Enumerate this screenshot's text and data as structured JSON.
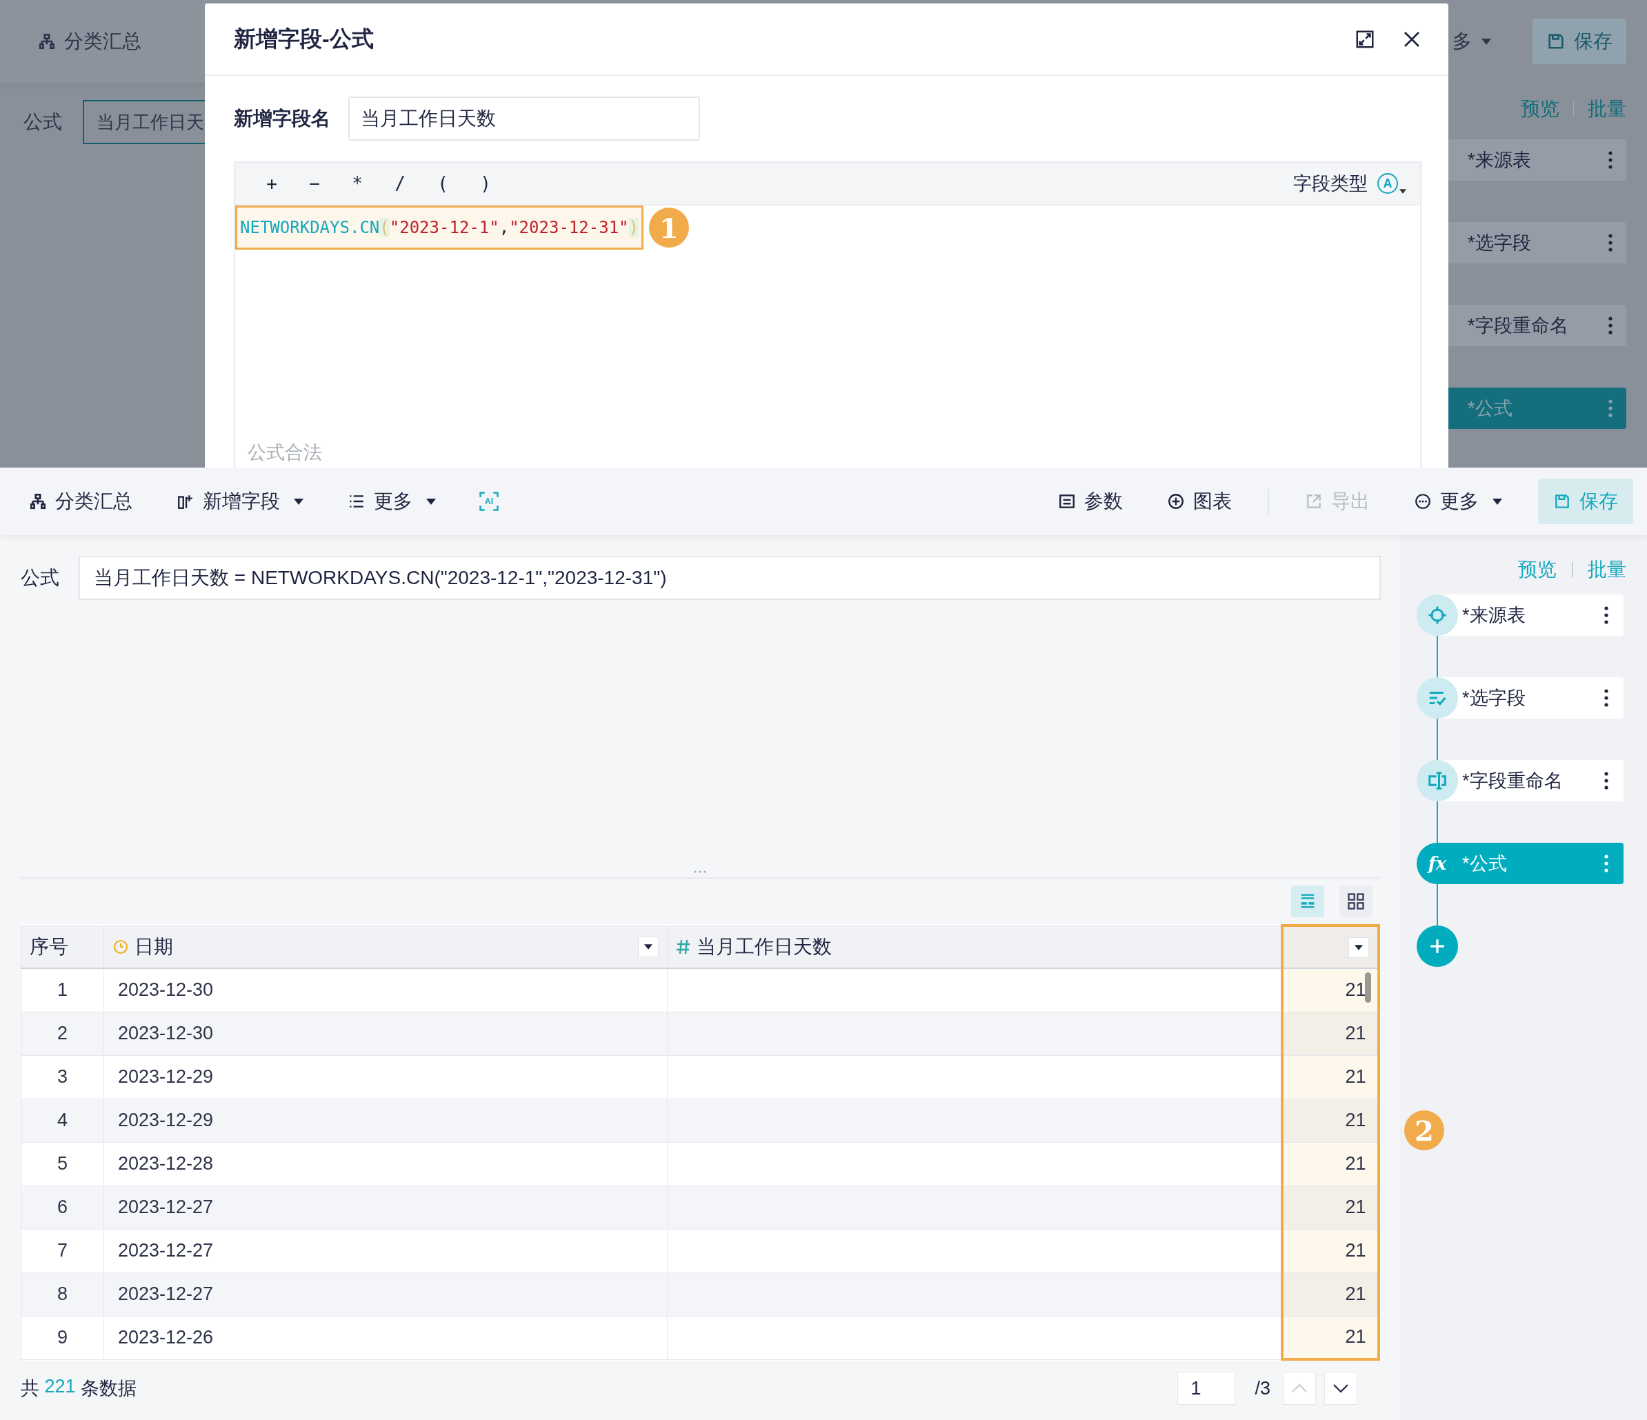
{
  "background": {
    "toolbar_label": "分类汇总",
    "formula_label": "公式",
    "formula_value": "当月工作日天",
    "more_label": "多",
    "save_label": "保存",
    "links": [
      "预览",
      "批量"
    ],
    "steps": [
      {
        "label": "*来源表",
        "selected": false
      },
      {
        "label": "*选字段",
        "selected": false
      },
      {
        "label": "*字段重命名",
        "selected": false
      },
      {
        "label": "*公式",
        "selected": true
      }
    ]
  },
  "dialog": {
    "title": "新增字段-公式",
    "name_label": "新增字段名",
    "name_value": "当月工作日天数",
    "operators": [
      "+",
      "−",
      "*",
      "/",
      "(",
      ")"
    ],
    "type_label": "字段类型",
    "type_badge": "A",
    "formula": [
      {
        "kind": "function",
        "text": "NETWORKDAYS.CN"
      },
      {
        "kind": "paren",
        "text": "("
      },
      {
        "kind": "string",
        "text": "\"2023-12-1\""
      },
      {
        "kind": "punct",
        "text": ","
      },
      {
        "kind": "string",
        "text": "\"2023-12-31\""
      },
      {
        "kind": "paren",
        "text": ")"
      }
    ],
    "callout": "1",
    "status": "公式合法"
  },
  "toolbar": {
    "left": [
      {
        "kind": "button",
        "label": "分类汇总",
        "caret": false
      },
      {
        "kind": "button",
        "label": "新增字段",
        "caret": true
      },
      {
        "kind": "button",
        "label": "更多",
        "caret": true
      },
      {
        "kind": "ai",
        "label": "AI",
        "caret": false
      }
    ],
    "right": [
      {
        "label": "参数",
        "caret": false,
        "disabled": false,
        "primary": false
      },
      {
        "label": "图表",
        "caret": false,
        "disabled": false,
        "primary": false
      },
      {
        "label": "导出",
        "caret": false,
        "disabled": true,
        "primary": false
      },
      {
        "label": "更多",
        "caret": true,
        "disabled": false,
        "primary": false
      },
      {
        "label": "保存",
        "caret": false,
        "disabled": false,
        "primary": true
      }
    ]
  },
  "formula_bar": {
    "label": "公式",
    "value": "当月工作日天数 = NETWORKDAYS.CN(\"2023-12-1\",\"2023-12-31\")"
  },
  "view_toggles": [
    {
      "selected": true
    },
    {
      "selected": false
    }
  ],
  "table": {
    "columns": [
      {
        "label": "序号",
        "filter": false,
        "highlighted": false
      },
      {
        "label": "日期",
        "filter": true,
        "highlighted": false
      },
      {
        "label": "当月工作日天数",
        "filter": false,
        "highlighted": false
      },
      {
        "filter": true,
        "highlighted": true
      }
    ],
    "rows": [
      {
        "index": "1",
        "date": "2023-12-30",
        "value": "21"
      },
      {
        "index": "2",
        "date": "2023-12-30",
        "value": "21"
      },
      {
        "index": "3",
        "date": "2023-12-29",
        "value": "21"
      },
      {
        "index": "4",
        "date": "2023-12-29",
        "value": "21"
      },
      {
        "index": "5",
        "date": "2023-12-28",
        "value": "21"
      },
      {
        "index": "6",
        "date": "2023-12-27",
        "value": "21"
      },
      {
        "index": "7",
        "date": "2023-12-27",
        "value": "21"
      },
      {
        "index": "8",
        "date": "2023-12-27",
        "value": "21"
      },
      {
        "index": "9",
        "date": "2023-12-26",
        "value": "21"
      }
    ]
  },
  "footer": {
    "prefix": "共",
    "count": "221",
    "suffix": "条数据",
    "page": "1",
    "pages": "/3",
    "prev_disabled": true,
    "next_disabled": false
  },
  "panel": {
    "links": [
      "预览",
      "批量"
    ],
    "steps": [
      {
        "label": "*来源表",
        "selected": false
      },
      {
        "label": "*选字段",
        "selected": false
      },
      {
        "label": "*字段重命名",
        "selected": false
      },
      {
        "label": "*公式",
        "selected": true,
        "icon_text": "fx"
      }
    ]
  },
  "callout": "2"
}
